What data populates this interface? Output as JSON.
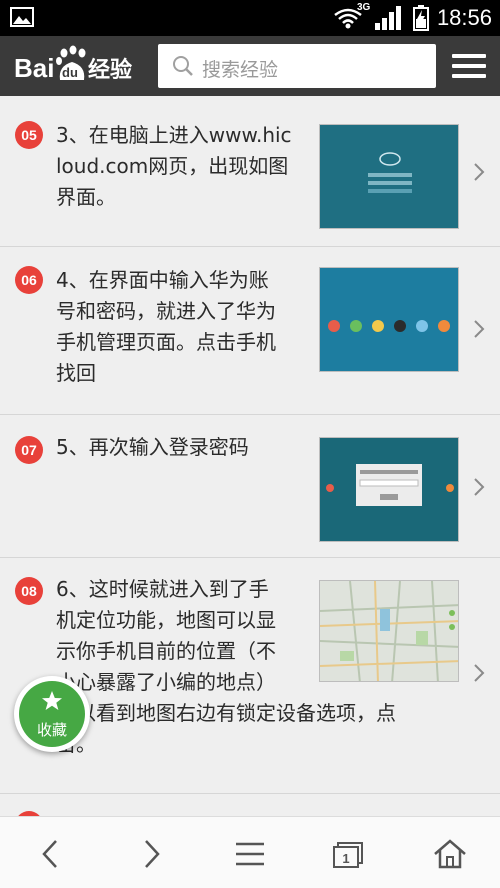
{
  "status_bar": {
    "network_label": "3G",
    "time": "18:56"
  },
  "header": {
    "logo_text_left": "Bai",
    "logo_text_paw": "du",
    "logo_text_right": "经验",
    "search_placeholder": "搜索经验"
  },
  "steps": [
    {
      "badge": "05",
      "text": "3、在电脑上进入www.hicloud.com网页，出现如图界面。",
      "lines": [
        "3、在电脑上进入www.hic",
        "loud.com网页，出现如图",
        "界面。"
      ]
    },
    {
      "badge": "06",
      "text": "4、在界面中输入华为账号和密码，就进入了华为手机管理页面。点击手机找回",
      "lines": [
        "4、在界面中输入华为账",
        "号和密码，就进入了华为",
        "手机管理页面。点击手机",
        "找回"
      ]
    },
    {
      "badge": "07",
      "text": "5、再次输入登录密码",
      "lines": [
        "5、再次输入登录密码"
      ]
    },
    {
      "badge": "08",
      "text": "6、这时候就进入到了手机定位功能，地图可以显示你手机目前的位置（不小心暴露了小编的地点）可以看到地图右边有锁定设备选项，点击。",
      "lines": [
        "6、这时候就进入到了手",
        "机定位功能，地图可以显",
        "示你手机目前的位置（不",
        "小心暴露了小编的地点）",
        "可以看到地图右边有锁定设备选项，点",
        "击。"
      ]
    }
  ],
  "favorite": {
    "label": "收藏",
    "color": "#46a844"
  },
  "bottom_nav": {
    "tab_count": "1"
  },
  "colors": {
    "badge_red": "#e8413a",
    "header_bg": "#3a3a3a",
    "thumb_teal": "#1f6f80"
  }
}
